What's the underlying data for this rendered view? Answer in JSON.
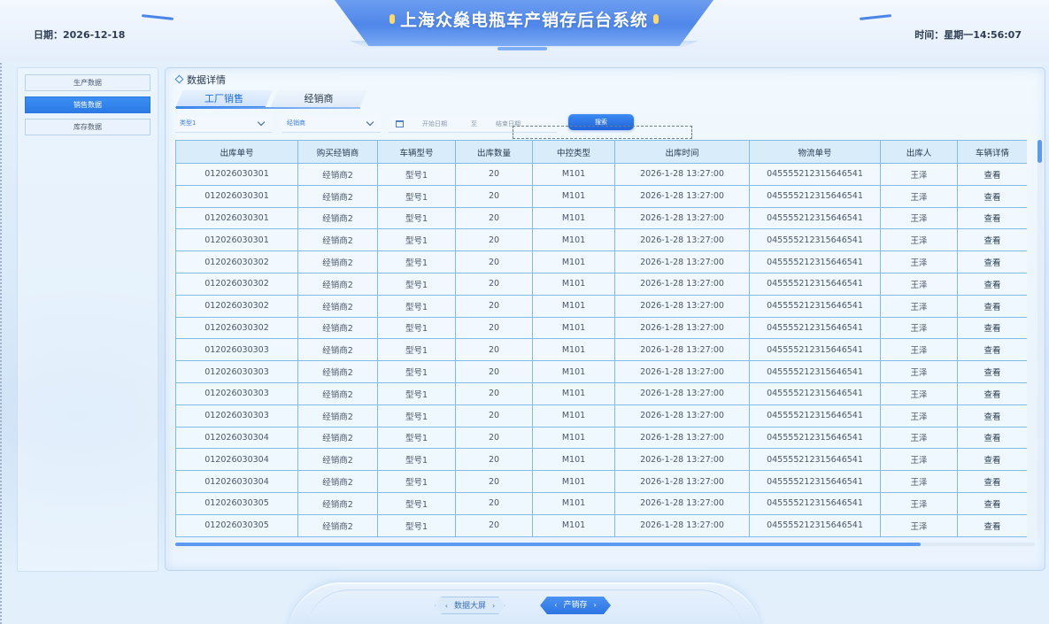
{
  "header": {
    "title": "上海众燊电瓶车产销存后台系统",
    "date": "日期：2026-12-18",
    "time": "时间：星期一14:56:07"
  },
  "sidebar": {
    "items": [
      {
        "label": "生产数据",
        "active": false
      },
      {
        "label": "销售数据",
        "active": true
      },
      {
        "label": "库存数据",
        "active": false
      }
    ]
  },
  "panel": {
    "title": "数据详情",
    "tabs": [
      {
        "label": "工厂销售",
        "active": true
      },
      {
        "label": "经销商",
        "active": false
      }
    ]
  },
  "filters": {
    "type_select": "类型1",
    "dealer_select": "经销商",
    "start_date_placeholder": "开始日期",
    "separator": "至",
    "end_date_placeholder": "结束日期",
    "search_label": "搜索"
  },
  "table": {
    "columns": [
      "出库单号",
      "购买经销商",
      "车辆型号",
      "出库数量",
      "中控类型",
      "出库时间",
      "物流单号",
      "出库人",
      "车辆详情"
    ],
    "rows": [
      [
        "012026030301",
        "经销商2",
        "型号1",
        "20",
        "M101",
        "2026-1-28  13:27:00",
        "045555212315646541",
        "王泽",
        "查看"
      ],
      [
        "012026030301",
        "经销商2",
        "型号1",
        "20",
        "M101",
        "2026-1-28  13:27:00",
        "045555212315646541",
        "王泽",
        "查看"
      ],
      [
        "012026030301",
        "经销商2",
        "型号1",
        "20",
        "M101",
        "2026-1-28  13:27:00",
        "045555212315646541",
        "王泽",
        "查看"
      ],
      [
        "012026030301",
        "经销商2",
        "型号1",
        "20",
        "M101",
        "2026-1-28  13:27:00",
        "045555212315646541",
        "王泽",
        "查看"
      ],
      [
        "012026030302",
        "经销商2",
        "型号1",
        "20",
        "M101",
        "2026-1-28  13:27:00",
        "045555212315646541",
        "王泽",
        "查看"
      ],
      [
        "012026030302",
        "经销商2",
        "型号1",
        "20",
        "M101",
        "2026-1-28  13:27:00",
        "045555212315646541",
        "王泽",
        "查看"
      ],
      [
        "012026030302",
        "经销商2",
        "型号1",
        "20",
        "M101",
        "2026-1-28  13:27:00",
        "045555212315646541",
        "王泽",
        "查看"
      ],
      [
        "012026030302",
        "经销商2",
        "型号1",
        "20",
        "M101",
        "2026-1-28  13:27:00",
        "045555212315646541",
        "王泽",
        "查看"
      ],
      [
        "012026030303",
        "经销商2",
        "型号1",
        "20",
        "M101",
        "2026-1-28  13:27:00",
        "045555212315646541",
        "王泽",
        "查看"
      ],
      [
        "012026030303",
        "经销商2",
        "型号1",
        "20",
        "M101",
        "2026-1-28  13:27:00",
        "045555212315646541",
        "王泽",
        "查看"
      ],
      [
        "012026030303",
        "经销商2",
        "型号1",
        "20",
        "M101",
        "2026-1-28  13:27:00",
        "045555212315646541",
        "王泽",
        "查看"
      ],
      [
        "012026030303",
        "经销商2",
        "型号1",
        "20",
        "M101",
        "2026-1-28  13:27:00",
        "045555212315646541",
        "王泽",
        "查看"
      ],
      [
        "012026030304",
        "经销商2",
        "型号1",
        "20",
        "M101",
        "2026-1-28  13:27:00",
        "045555212315646541",
        "王泽",
        "查看"
      ],
      [
        "012026030304",
        "经销商2",
        "型号1",
        "20",
        "M101",
        "2026-1-28  13:27:00",
        "045555212315646541",
        "王泽",
        "查看"
      ],
      [
        "012026030304",
        "经销商2",
        "型号1",
        "20",
        "M101",
        "2026-1-28  13:27:00",
        "045555212315646541",
        "王泽",
        "查看"
      ],
      [
        "012026030305",
        "经销商2",
        "型号1",
        "20",
        "M101",
        "2026-1-28  13:27:00",
        "045555212315646541",
        "王泽",
        "查看"
      ],
      [
        "012026030305",
        "经销商2",
        "型号1",
        "20",
        "M101",
        "2026-1-28  13:27:00",
        "045555212315646541",
        "王泽",
        "查看"
      ]
    ]
  },
  "footer": {
    "nav": [
      {
        "label": "数据大屏",
        "active": false
      },
      {
        "label": "产销存",
        "active": true
      }
    ]
  },
  "colors": {
    "accent": "#2c7ae6",
    "title_plate": "#4f86ea",
    "table_border": "#7fbde6",
    "table_header_bg": "#d8ecfa"
  },
  "icons": {
    "calendar": "calendar-icon",
    "diamond": "diamond-icon",
    "chevron": "chevron-down-icon"
  }
}
